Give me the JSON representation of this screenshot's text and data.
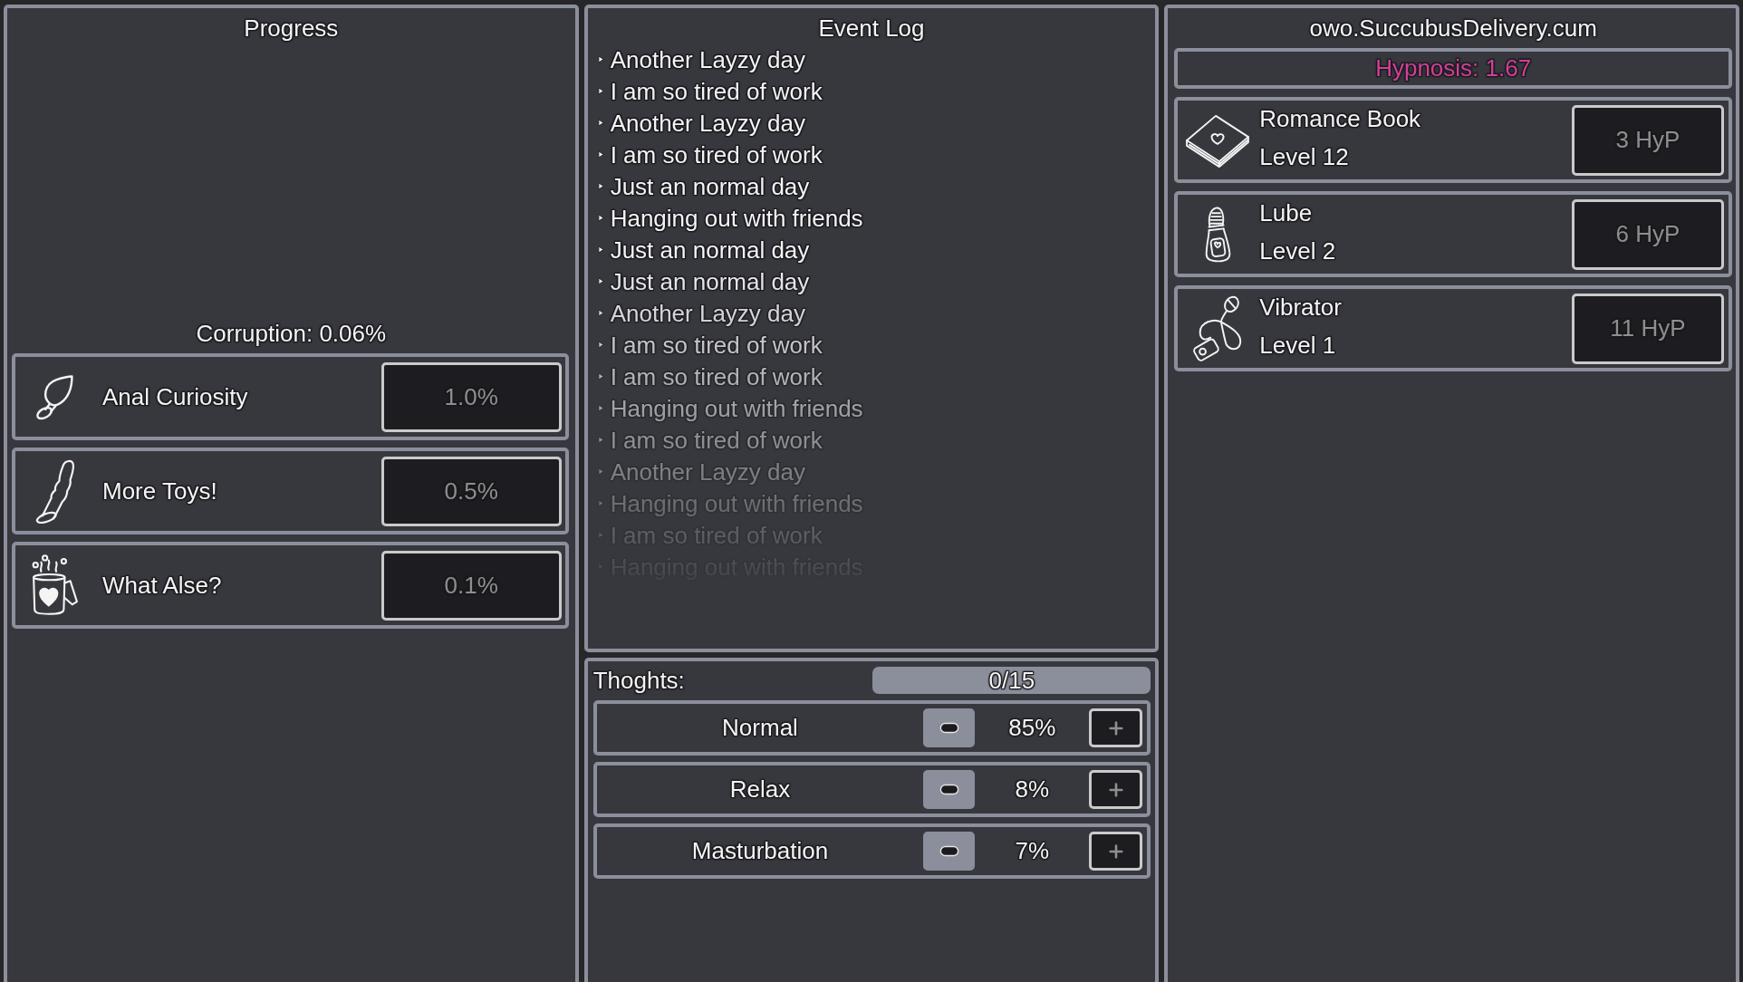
{
  "progress_panel": {
    "title": "Progress",
    "corruption": "Corruption: 0.06%",
    "upgrades": [
      {
        "label": "Anal Curiosity",
        "value": "1.0%",
        "disabled": true
      },
      {
        "label": "More Toys!",
        "value": "0.5%",
        "disabled": true
      },
      {
        "label": "What Alse?",
        "value": "0.1%",
        "disabled": true
      }
    ]
  },
  "event_log": {
    "title": "Event Log",
    "entries": [
      "Another Layzy day",
      "I am so tired of work",
      "Another Layzy day",
      "I am so tired of work",
      "Just an normal day",
      "Hanging out with friends",
      "Just an normal day",
      "Just an normal day",
      "Another Layzy day",
      "I am so tired of work",
      "I am so tired of work",
      "Hanging out with friends",
      "I am so tired of work",
      "Another Layzy day",
      "Hanging out with friends",
      "I am so tired of work",
      "Hanging out with friends"
    ]
  },
  "thoughts": {
    "label": "Thoghts:",
    "counter": "0/15",
    "rows": [
      {
        "name": "Normal",
        "percent": "85%",
        "decrease_disabled": false,
        "increase_disabled": true
      },
      {
        "name": "Relax",
        "percent": "8%",
        "decrease_disabled": false,
        "increase_disabled": true
      },
      {
        "name": "Masturbation",
        "percent": "7%",
        "decrease_disabled": false,
        "increase_disabled": true
      }
    ]
  },
  "shop": {
    "title": "owo.SuccubusDelivery.cum",
    "currency": "Hypnosis: 1.67",
    "items": [
      {
        "name": "Romance Book",
        "rank": "Level 12",
        "cost": "3 HyP",
        "disabled": true
      },
      {
        "name": "Lube",
        "rank": "Level 2",
        "cost": "6 HyP",
        "disabled": true
      },
      {
        "name": "Vibrator",
        "rank": "Level 1",
        "cost": "11 HyP",
        "disabled": true
      }
    ]
  }
}
